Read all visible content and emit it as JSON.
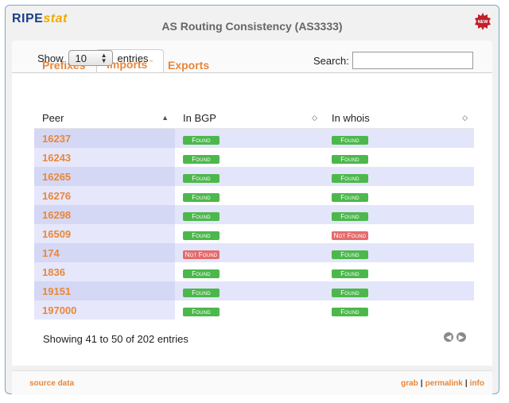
{
  "app": {
    "logo_ripe": "RIPE",
    "logo_stat": "stat",
    "title": "AS Routing Consistency (AS3333)",
    "new_badge": "NEW"
  },
  "tabs": [
    {
      "label": "Prefixes",
      "mark": "~"
    },
    {
      "label": "Imports",
      "mark": "~"
    },
    {
      "label": "Exports"
    }
  ],
  "controls": {
    "show_label": "Show",
    "entries_value": "10",
    "entries_label": "entries",
    "search_label": "Search:",
    "search_value": ""
  },
  "table": {
    "headers": [
      "Peer",
      "In BGP",
      "In whois"
    ],
    "rows": [
      {
        "peer": "16237",
        "bgp": "Found",
        "whois": "Found"
      },
      {
        "peer": "16243",
        "bgp": "Found",
        "whois": "Found"
      },
      {
        "peer": "16265",
        "bgp": "Found",
        "whois": "Found"
      },
      {
        "peer": "16276",
        "bgp": "Found",
        "whois": "Found"
      },
      {
        "peer": "16298",
        "bgp": "Found",
        "whois": "Found"
      },
      {
        "peer": "16509",
        "bgp": "Found",
        "whois": "Not Found"
      },
      {
        "peer": "174",
        "bgp": "Not Found",
        "whois": "Found"
      },
      {
        "peer": "1836",
        "bgp": "Found",
        "whois": "Found"
      },
      {
        "peer": "19151",
        "bgp": "Found",
        "whois": "Found"
      },
      {
        "peer": "197000",
        "bgp": "Found",
        "whois": "Found"
      }
    ]
  },
  "info_text": "Showing 41 to 50 of 202 entries",
  "footer": {
    "source": "source data",
    "links": [
      "grab",
      "permalink",
      "info"
    ]
  },
  "colors": {
    "accent": "#e8873a",
    "found": "#4cb84c",
    "not_found": "#e46c6c",
    "brand_blue": "#1b3e86"
  }
}
